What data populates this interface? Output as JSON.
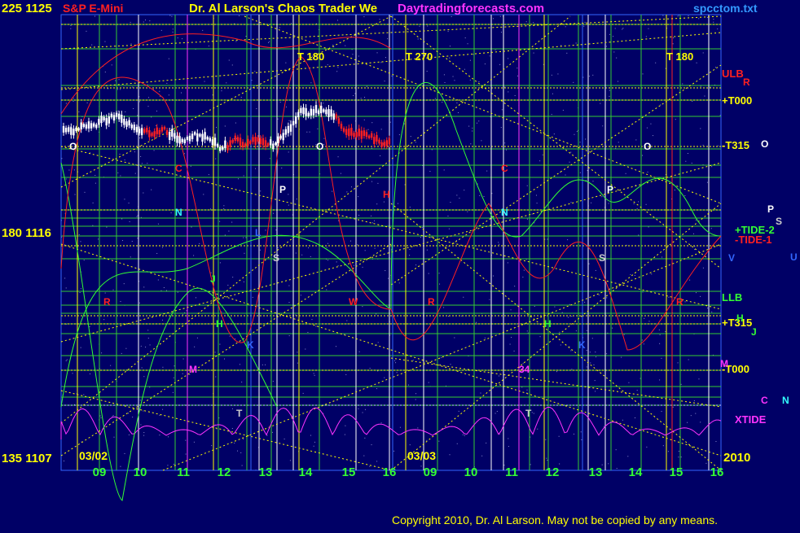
{
  "header": {
    "left_price_top": "225  1125",
    "instrument": "S&P E-Mini",
    "title": "Dr. Al Larson's Chaos Trader We",
    "site": "Daytradingforecasts.com",
    "file": "spcctom.txt"
  },
  "left_axis": {
    "mid_label": "180  1116",
    "bottom_label": "135  1107"
  },
  "footer": {
    "copyright": "Copyright 2010, Dr. Al Larson. May not be copied by any means."
  },
  "colors": {
    "background": "#000066",
    "grid_green": "#33cc33",
    "yellow": "#ffff00",
    "red": "#ff2020",
    "magenta": "#ff33ff",
    "cyan": "#33ffff",
    "white": "#ffffff"
  },
  "chart_data": {
    "type": "line",
    "instrument": "S&P E-Mini",
    "y_axis_left_labels": [
      {
        "value": 1125,
        "text": "225  1125"
      },
      {
        "value": 1116,
        "text": "180  1116"
      },
      {
        "value": 1107,
        "text": "135  1107"
      }
    ],
    "ylim": [
      1107,
      1125
    ],
    "x_tick_labels": [
      "09",
      "10",
      "11",
      "12",
      "13",
      "14",
      "15",
      "16",
      "09",
      "10",
      "11",
      "12",
      "13",
      "14",
      "15",
      "16"
    ],
    "date_labels": [
      "03/02",
      "03/03"
    ],
    "year_label": "2010",
    "top_markers": [
      "T 180",
      "T 270",
      "T 180"
    ],
    "right_level_labels": [
      {
        "text": "ULB",
        "color": "#ff2020"
      },
      {
        "text": "+T000",
        "color": "#ffff00"
      },
      {
        "text": "-T315",
        "color": "#ffff00"
      },
      {
        "text": "+TIDE-2",
        "color": "#33ff33"
      },
      {
        "text": "-TIDE-1",
        "color": "#ff2020"
      },
      {
        "text": "LLB",
        "color": "#33ff33"
      },
      {
        "text": "+T315",
        "color": "#ffff00"
      },
      {
        "text": "-T000",
        "color": "#ffff00"
      },
      {
        "text": "XTIDE",
        "color": "#ff33ff"
      }
    ],
    "right_margin_letters": [
      "R",
      "O",
      "P",
      "S",
      "V",
      "U",
      "H",
      "J",
      "M",
      "C",
      "N"
    ],
    "annotations": [
      "O",
      "C",
      "N",
      "P",
      "S",
      "R",
      "J",
      "H",
      "M",
      "K",
      "W",
      "L",
      "T",
      "34"
    ]
  }
}
